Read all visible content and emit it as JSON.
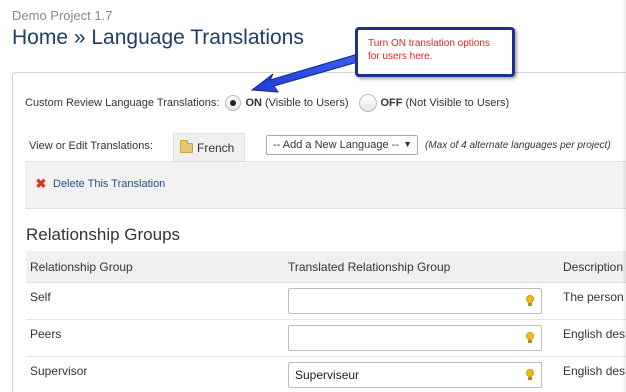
{
  "header": {
    "project_name": "Demo Project 1.7",
    "page_title": "Home » Language Translations"
  },
  "review": {
    "label": "Custom Review Language Translations:",
    "on_label": "ON",
    "on_note": "(Visible to Users)",
    "off_label": "OFF",
    "off_note": "(Not Visible to Users)",
    "selected": "on"
  },
  "translations": {
    "label": "View or Edit Translations:",
    "active_tab": "French",
    "select_value": "-- Add a New Language --",
    "max_note": "(Max of 4 alternate languages per project)",
    "delete_label": "Delete This Translation"
  },
  "callout": {
    "text": "Turn ON translation options for users here."
  },
  "relationship_groups": {
    "title": "Relationship Groups",
    "columns": [
      "Relationship Group",
      "Translated Relationship Group",
      "Description"
    ],
    "rows": [
      {
        "group": "Self",
        "translated": "",
        "description": "The person"
      },
      {
        "group": "Peers",
        "translated": "",
        "description": "English des"
      },
      {
        "group": "Supervisor",
        "translated": "Superviseur",
        "description": "English des"
      }
    ]
  },
  "colors": {
    "title": "#1f3d63",
    "callout_border": "#1c2f8a",
    "callout_text": "#e8241e",
    "delete_icon": "#d63a2c"
  }
}
